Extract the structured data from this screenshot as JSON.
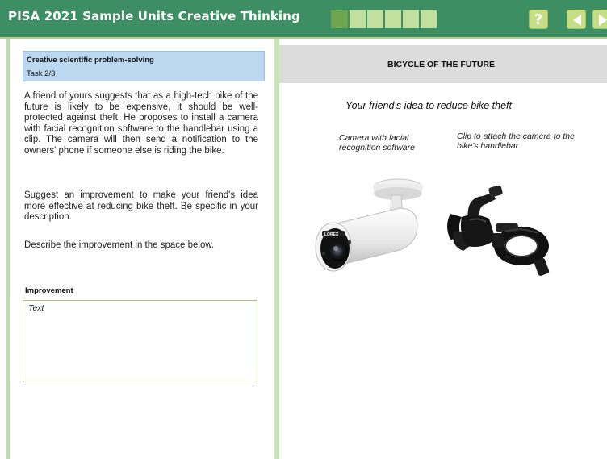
{
  "header": {
    "title": "PISA 2021 Sample Units Creative Thinking",
    "progress": {
      "current": 1,
      "total": 6
    },
    "help_label": "?"
  },
  "task": {
    "type": "Creative scientific problem-solving",
    "number": "Task 2/3"
  },
  "question": {
    "paragraph1": "A friend of yours suggests that as a high-tech bike of the future is likely to be expensive, it should be well-protected against theft. He proposes to install a camera with facial recognition software to the handlebar using a clip. The camera will then send a notification to the owners' phone if someone else is riding the bike.",
    "paragraph2": "Suggest an improvement to make your friend's idea more effective at reducing bike theft. Be specific in your description.",
    "paragraph3": "Describe the improvement  in the space below."
  },
  "answer": {
    "label": "Improvement",
    "placeholder": "Text"
  },
  "stimulus": {
    "title": "BICYCLE OF THE FUTURE",
    "subtitle": "Your friend's idea to reduce bike theft",
    "caption_camera": "Camera with  facial recognition software",
    "caption_clip": "Clip to attach the camera to the bike's handlebar",
    "camera_brand": "LOREX"
  },
  "colors": {
    "header_bg": "#3d8f63",
    "accent_light": "#c7dd86",
    "task_box": "#bcd7f0",
    "divider": "#c6e6b6"
  }
}
